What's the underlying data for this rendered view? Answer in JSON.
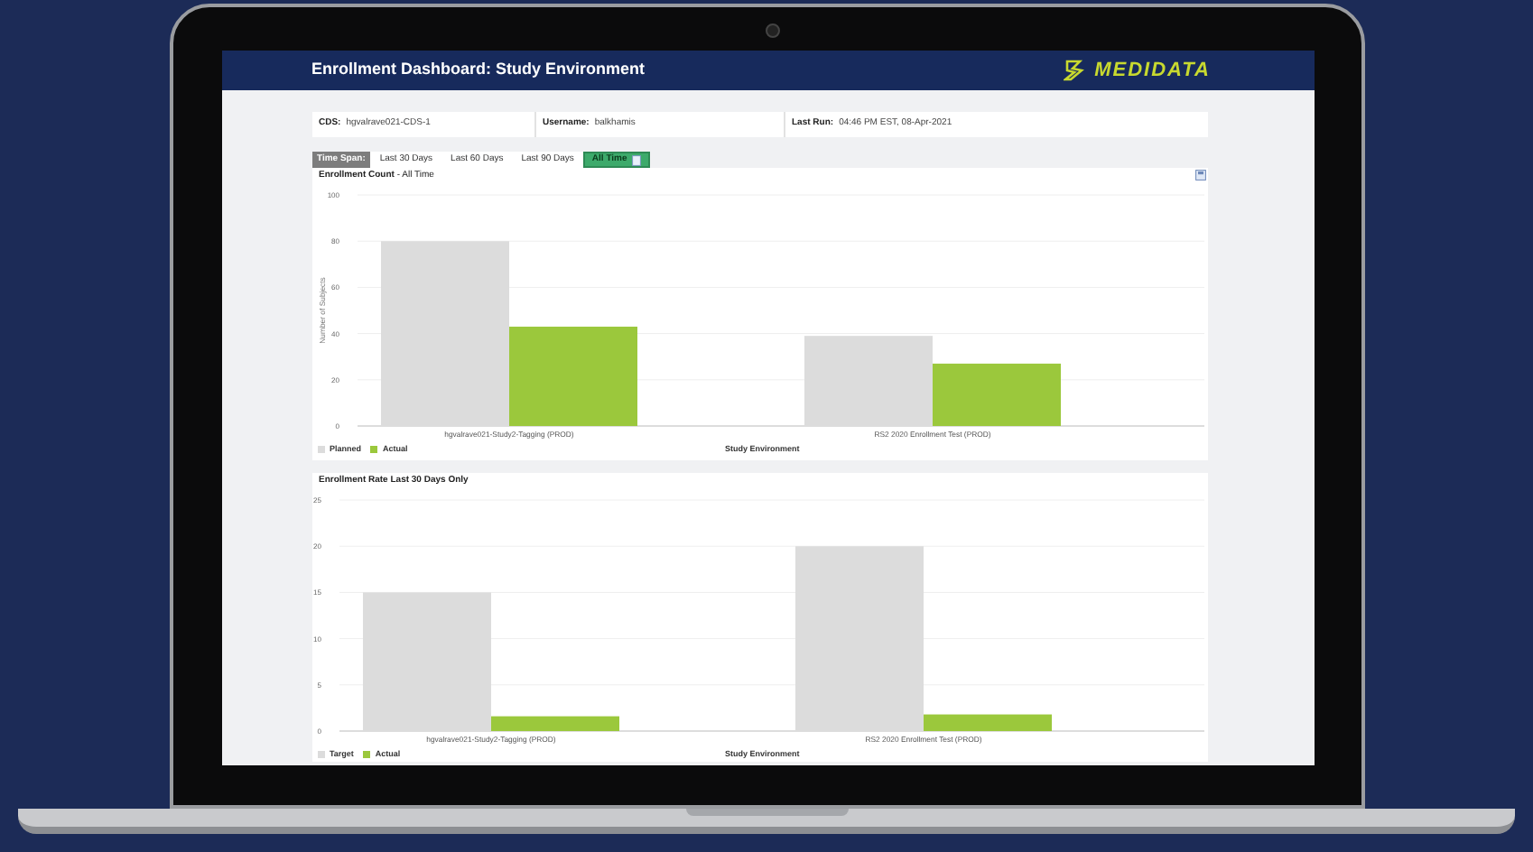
{
  "header": {
    "title": "Enrollment Dashboard: Study Environment",
    "logo": "MEDIDATA"
  },
  "info": [
    {
      "label": "CDS:",
      "value": "hgvalrave021-CDS-1"
    },
    {
      "label": "Username:",
      "value": "balkhamis"
    },
    {
      "label": "Last Run:",
      "value": "04:46 PM EST, 08-Apr-2021"
    }
  ],
  "time_span": {
    "label": "Time Span:",
    "tabs": [
      {
        "label": "Last 30 Days",
        "selected": false
      },
      {
        "label": "Last 60 Days",
        "selected": false
      },
      {
        "label": "Last 90 Days",
        "selected": false
      },
      {
        "label": "All Time",
        "selected": true
      }
    ]
  },
  "charts": [
    {
      "title": "**Enrollment Count** - All Time",
      "chart_data": {
        "type": "bar",
        "xlabel": "Study Environment",
        "ylabel": "Number of Subjects",
        "categories": [
          "hgvalrave021-Study2-Tagging (PROD)",
          "RS2 2020 Enrollment Test (PROD)"
        ],
        "series": [
          {
            "name": "Planned",
            "color": "#dcdcdc",
            "values": [
              80,
              39
            ]
          },
          {
            "name": "Actual",
            "color": "#9bc83c",
            "values": [
              43,
              27
            ]
          }
        ],
        "ylim": [
          0,
          100
        ],
        "yticks": [
          0,
          20,
          40,
          60,
          80,
          100
        ],
        "grid": true
      }
    },
    {
      "title": "**Enrollment Rate Last 30 Days Only**",
      "chart_data": {
        "type": "bar",
        "xlabel": "Study Environment",
        "categories": [
          "hgvalrave021-Study2-Tagging (PROD)",
          "RS2 2020 Enrollment Test (PROD)"
        ],
        "series": [
          {
            "name": "Target",
            "color": "#dcdcdc",
            "values": [
              15,
              20
            ]
          },
          {
            "name": "Actual",
            "color": "#9bc83c",
            "values": [
              1.6,
              1.8
            ]
          }
        ],
        "ylim": [
          0,
          25
        ],
        "yticks": [
          0,
          5,
          10,
          15,
          20,
          25
        ],
        "grid": true
      }
    }
  ]
}
